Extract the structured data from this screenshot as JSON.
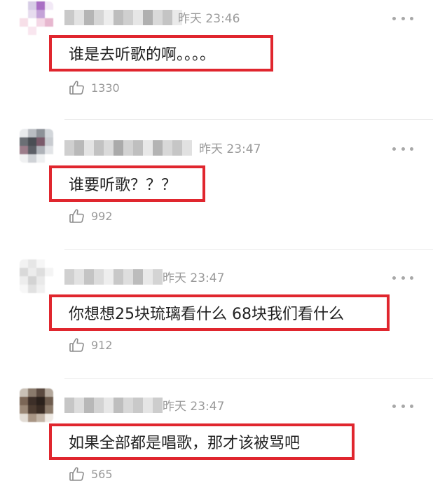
{
  "comments": [
    {
      "time": "昨天 23:46",
      "text": "谁是去听歌的啊。。。。",
      "likes": "1330",
      "avatar_colors": [
        "#ffffff",
        "#d7cde6",
        "#a96ec4",
        "#f2e9f6",
        "#ffffff",
        "#e7dcef",
        "#c4a3d8",
        "#ffffff",
        "#f7dfe8",
        "#ffffff",
        "#f4d8e6",
        "#e7b7cf",
        "#ffffff",
        "#f9e6ef",
        "#ffffff",
        "#ffffff"
      ]
    },
    {
      "time": "昨天 23:47",
      "text": "谁要听歌？？？",
      "likes": "992",
      "avatar_colors": [
        "#e8eaec",
        "#b9bdc2",
        "#8d9298",
        "#d2d6da",
        "#6b6f75",
        "#4a4e54",
        "#7a5a6a",
        "#c8cbd0",
        "#9c7d8a",
        "#5c5f66",
        "#aeb2b8",
        "#e2e4e7",
        "#f0f1f2",
        "#cfd2d6",
        "#eef0f1",
        "#ffffff"
      ]
    },
    {
      "time": "昨天 23:47",
      "text": "你想想25块琉璃看什么 68块我们看什么",
      "likes": "912",
      "avatar_colors": [
        "#f2f2f2",
        "#e6e6e6",
        "#f6f6f6",
        "#ffffff",
        "#d9d9d9",
        "#ececec",
        "#dedede",
        "#f4f4f4",
        "#ededed",
        "#d3d3d3",
        "#e9e9e9",
        "#ffffff",
        "#f7f7f7",
        "#e1e1e1",
        "#f0f0f0",
        "#ffffff"
      ]
    },
    {
      "time": "昨天 23:47",
      "text": "如果全部都是唱歌，那才该被骂吧",
      "likes": "565",
      "avatar_colors": [
        "#c9c0b6",
        "#8a7a6c",
        "#5b4a40",
        "#b3a79b",
        "#7b6656",
        "#3d2f28",
        "#2b211c",
        "#6e5c4e",
        "#9b8877",
        "#4d3c31",
        "#3a2c24",
        "#8c7b6b",
        "#e2dcd5",
        "#a89584",
        "#c2b4a6",
        "#efeae4"
      ]
    }
  ]
}
